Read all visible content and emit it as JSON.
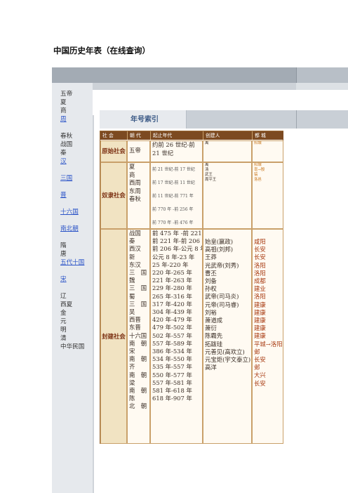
{
  "page_title": "中国历史年表（在线查询）",
  "sidebar": [
    {
      "label": "五帝",
      "link": false
    },
    {
      "label": "夏",
      "link": false
    },
    {
      "label": "商",
      "link": false
    },
    {
      "label": "周",
      "link": true
    },
    {
      "label": "",
      "link": false
    },
    {
      "label": "春秋",
      "link": false
    },
    {
      "label": "战国",
      "link": false
    },
    {
      "label": "秦",
      "link": false
    },
    {
      "label": "汉",
      "link": true
    },
    {
      "label": "",
      "link": false
    },
    {
      "label": "三国",
      "link": true
    },
    {
      "label": "",
      "link": false
    },
    {
      "label": "晋",
      "link": true
    },
    {
      "label": "",
      "link": false
    },
    {
      "label": "十六国",
      "link": true
    },
    {
      "label": "",
      "link": false
    },
    {
      "label": "南北朝",
      "link": true
    },
    {
      "label": "",
      "link": false
    },
    {
      "label": "隋",
      "link": false
    },
    {
      "label": "唐",
      "link": false
    },
    {
      "label": "五代十国",
      "link": true
    },
    {
      "label": "",
      "link": false
    },
    {
      "label": "宋",
      "link": true
    },
    {
      "label": "",
      "link": false
    },
    {
      "label": "辽",
      "link": false
    },
    {
      "label": "西夏",
      "link": false
    },
    {
      "label": "金",
      "link": false
    },
    {
      "label": "元",
      "link": false
    },
    {
      "label": "明",
      "link": false
    },
    {
      "label": "清",
      "link": false
    },
    {
      "label": "中华民国",
      "link": false
    }
  ],
  "section_title": "年号索引",
  "table": {
    "headers": [
      "社 会",
      "朝 代",
      "起止年代",
      "创建人",
      "都 城"
    ],
    "rows": [
      {
        "society": "原始社会",
        "dynasties": [
          "五帝"
        ],
        "periods": [
          "约前 26 世纪-前 21 世纪"
        ],
        "founders": [
          "禹"
        ],
        "capitals": [
          "阳城"
        ]
      },
      {
        "society": "奴隶社会",
        "dynasties": [
          "夏",
          "商",
          "西周",
          "东周",
          "春秋"
        ],
        "periods": [
          "前 21 世纪-前 17 世纪",
          "前 17 世纪-前 11 世纪",
          "前 11 世纪-前 771 年",
          "前 770 年 -前 256 年",
          "前 770 年 -前 476 年"
        ],
        "founders": [
          "禹",
          "汤",
          "武王",
          "周平王"
        ],
        "capitals": [
          "阳城",
          "亳→殷",
          "镐",
          "洛邑"
        ]
      },
      {
        "society": "封建社会",
        "dynasties": [
          "战国",
          "秦",
          "西汉",
          "新",
          "东汉",
          "三　国",
          "魏",
          "三　国",
          "蜀",
          "三　国",
          "吴",
          "西晋",
          "东晋",
          "十六国",
          "南　朝",
          "宋",
          "南　朝",
          "齐",
          "南　朝",
          "梁",
          "南　朝",
          "陈",
          "北　朝"
        ],
        "periods": [
          "前 475 年 -前 221 年",
          "前 221 年-前 206 年",
          "前 206 年-公元 8 年",
          "公元 8 年-23 年",
          "25 年-220 年",
          "220 年-265 年",
          "221 年-263 年",
          "229 年-280 年",
          "265 年-316 年",
          "317 年-420 年",
          "304 年-439 年",
          "420 年-479 年",
          "479 年-502 年",
          "502 年-557 年",
          "557 年-589 年",
          "386 年-534 年",
          "534 年-550 年",
          "535 年-557 年",
          "550 年-577 年",
          "557 年-581 年",
          "581 年-618 年",
          "618 年-907 年"
        ],
        "founders": [
          "始皇(嬴政)",
          "高祖(刘邦)",
          "王莽",
          "光武帝(刘秀)",
          "曹丕",
          "刘备",
          "孙权",
          "武帝(司马炎)",
          "元帝(司马睿)",
          "",
          "",
          "",
          "刘裕",
          "萧道成",
          "萧衍",
          "陈霸先",
          "拓跋珪",
          "元善见(高欢立)",
          "元宝炬(宇文泰立)",
          "高洋"
        ],
        "capitals": [
          "咸阳",
          "长安",
          "长安",
          "洛阳",
          "洛阳",
          "成都",
          "建业",
          "洛阳",
          "建康",
          "",
          "建康",
          "建康",
          "建康",
          "建康",
          "平城→洛阳",
          "邺",
          "长安",
          "邺",
          "大兴",
          "长安"
        ]
      }
    ]
  }
}
